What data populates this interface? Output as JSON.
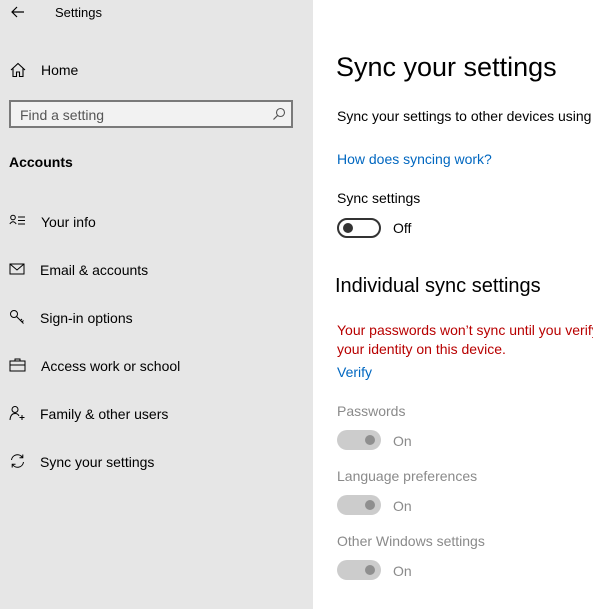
{
  "window": {
    "title": "Settings"
  },
  "sidebar": {
    "home_label": "Home",
    "search_placeholder": "Find a setting",
    "section_heading": "Accounts",
    "items": [
      {
        "label": "Your info",
        "icon": "contact-card-icon"
      },
      {
        "label": "Email & accounts",
        "icon": "mail-icon"
      },
      {
        "label": "Sign-in options",
        "icon": "key-icon"
      },
      {
        "label": "Access work or school",
        "icon": "briefcase-icon"
      },
      {
        "label": "Family & other users",
        "icon": "person-add-icon"
      },
      {
        "label": "Sync your settings",
        "icon": "sync-icon"
      }
    ]
  },
  "main": {
    "title": "Sync your settings",
    "description": "Sync your settings to other devices using",
    "how_link": "How does syncing work?",
    "sync_settings": {
      "label": "Sync settings",
      "state": "Off"
    },
    "individual_heading": "Individual sync settings",
    "warning": "Your passwords won’t sync until you verify your identity on this device.",
    "verify_link": "Verify",
    "individual": [
      {
        "label": "Passwords",
        "state": "On"
      },
      {
        "label": "Language preferences",
        "state": "On"
      },
      {
        "label": "Other Windows settings",
        "state": "On"
      }
    ]
  },
  "colors": {
    "sidebar_bg": "#e6e6e6",
    "link": "#0067c0",
    "warning": "#b80000",
    "disabled_text": "#8a8a8a"
  }
}
